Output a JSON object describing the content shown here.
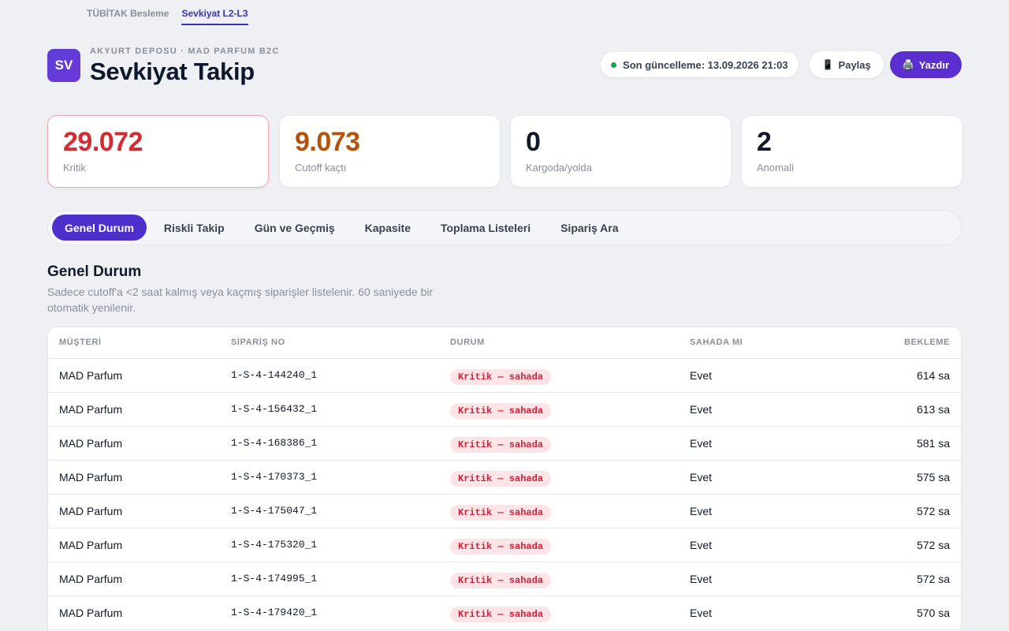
{
  "topnav": {
    "items": [
      "TÜBİTAK Besleme",
      "Sevkiyat L2-L3"
    ]
  },
  "header": {
    "logo": "SV",
    "eyebrow": "AKYURT DEPOSU · MAD PARFUM B2C",
    "title": "Sevkiyat Takip",
    "status": "Son güncelleme: 13.09.2026 21:03",
    "share_label": "Paylaş",
    "print_label": "Yazdır",
    "share_icon": "📱",
    "print_icon": "🖨️"
  },
  "cards": [
    {
      "value": "29.072",
      "label": "Kritik",
      "color": "#d52b32"
    },
    {
      "value": "9.073",
      "label": "Cutoff kaçtı",
      "color": "#b45309"
    },
    {
      "value": "0",
      "label": "Kargoda/yolda",
      "color": "#111827"
    },
    {
      "value": "2",
      "label": "Anomali",
      "color": "#111827"
    }
  ],
  "tabs": [
    "Genel Durum",
    "Riskli Takip",
    "Gün ve Geçmiş",
    "Kapasite",
    "Toplama Listeleri",
    "Sipariş Ara"
  ],
  "section": {
    "title": "Genel Durum",
    "desc": "Sadece cutoff'a <2 saat kalmış veya kaçmış siparişler listelenir. 60 saniyede bir otomatik yenilenir."
  },
  "table": {
    "headers": [
      "MÜŞTERİ",
      "SİPARİŞ NO",
      "DURUM",
      "SAHADA MI",
      "BEKLEME"
    ],
    "rows": [
      {
        "customer": "MAD Parfum",
        "order": "1-S-4-144240_1",
        "status": "Kritik — sahada",
        "field": "Evet",
        "wait": "614 sa"
      },
      {
        "customer": "MAD Parfum",
        "order": "1-S-4-156432_1",
        "status": "Kritik — sahada",
        "field": "Evet",
        "wait": "613 sa"
      },
      {
        "customer": "MAD Parfum",
        "order": "1-S-4-168386_1",
        "status": "Kritik — sahada",
        "field": "Evet",
        "wait": "581 sa"
      },
      {
        "customer": "MAD Parfum",
        "order": "1-S-4-170373_1",
        "status": "Kritik — sahada",
        "field": "Evet",
        "wait": "575 sa"
      },
      {
        "customer": "MAD Parfum",
        "order": "1-S-4-175047_1",
        "status": "Kritik — sahada",
        "field": "Evet",
        "wait": "572 sa"
      },
      {
        "customer": "MAD Parfum",
        "order": "1-S-4-175320_1",
        "status": "Kritik — sahada",
        "field": "Evet",
        "wait": "572 sa"
      },
      {
        "customer": "MAD Parfum",
        "order": "1-S-4-174995_1",
        "status": "Kritik — sahada",
        "field": "Evet",
        "wait": "572 sa"
      },
      {
        "customer": "MAD Parfum",
        "order": "1-S-4-179420_1",
        "status": "Kritik — sahada",
        "field": "Evet",
        "wait": "570 sa"
      }
    ]
  }
}
